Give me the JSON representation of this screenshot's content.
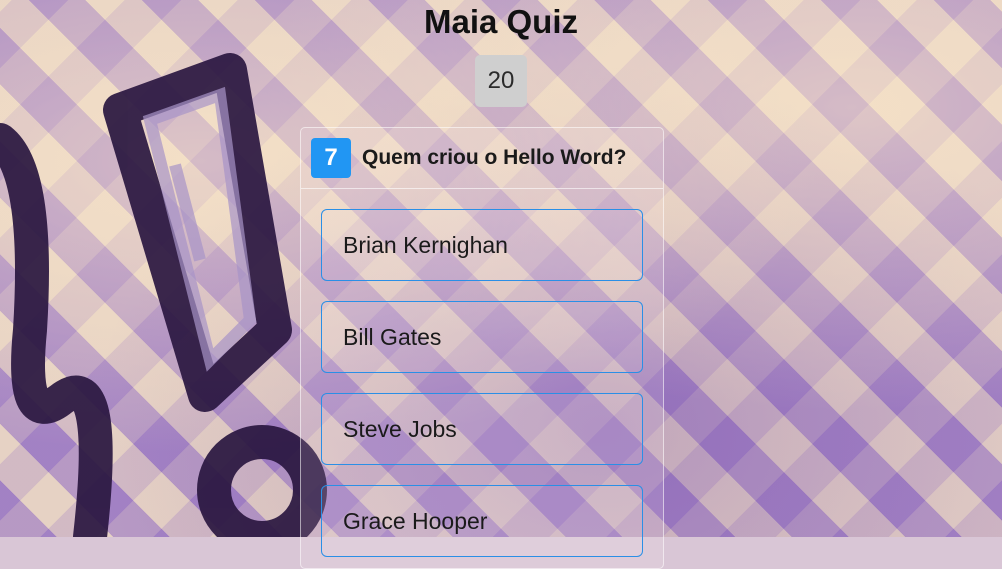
{
  "app": {
    "title": "Maia Quiz"
  },
  "timer": {
    "value": "20"
  },
  "question": {
    "number": "7",
    "text": "Quem criou o Hello Word?"
  },
  "answers": [
    {
      "label": "Brian Kernighan"
    },
    {
      "label": "Bill Gates"
    },
    {
      "label": "Steve Jobs"
    },
    {
      "label": "Grace Hooper"
    }
  ],
  "colors": {
    "accent": "#2196f3",
    "answer_border": "#2a8fe6",
    "timer_bg": "#cfcfcf"
  }
}
